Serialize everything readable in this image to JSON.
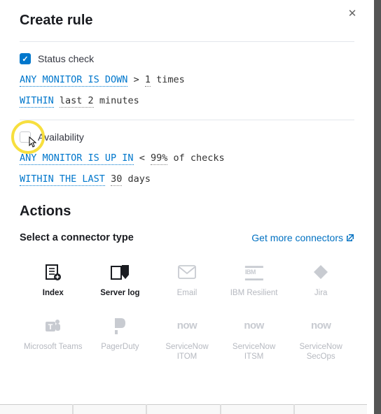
{
  "header": {
    "title": "Create rule"
  },
  "rule_status": {
    "label": "Status check",
    "checked": true,
    "expr1_kw": "ANY MONITOR IS DOWN",
    "expr1_op": ">",
    "expr1_val": "1",
    "expr1_unit": "times",
    "expr2_kw": "WITHIN",
    "expr2_time": "last 2",
    "expr2_unit": "minutes"
  },
  "rule_avail": {
    "label": "Availability",
    "checked": false,
    "expr1_kw": "ANY MONITOR IS UP IN",
    "expr1_op": "<",
    "expr1_val": "99%",
    "expr1_unit": "of checks",
    "expr2_kw": "WITHIN THE LAST",
    "expr2_val": "30",
    "expr2_unit": "days"
  },
  "actions": {
    "heading": "Actions",
    "select_label": "Select a connector type",
    "more_link": "Get more connectors"
  },
  "connectors": [
    {
      "name": "Index",
      "icon": "index",
      "enabled": true
    },
    {
      "name": "Server log",
      "icon": "serverlog",
      "enabled": true
    },
    {
      "name": "Email",
      "icon": "email",
      "enabled": false
    },
    {
      "name": "IBM Resilient",
      "icon": "ibm",
      "enabled": false
    },
    {
      "name": "Jira",
      "icon": "jira",
      "enabled": false
    },
    {
      "name": "Microsoft Teams",
      "icon": "teams",
      "enabled": false
    },
    {
      "name": "PagerDuty",
      "icon": "pagerduty",
      "enabled": false
    },
    {
      "name": "ServiceNow ITOM",
      "icon": "now",
      "enabled": false
    },
    {
      "name": "ServiceNow ITSM",
      "icon": "now",
      "enabled": false
    },
    {
      "name": "ServiceNow SecOps",
      "icon": "now",
      "enabled": false
    }
  ]
}
